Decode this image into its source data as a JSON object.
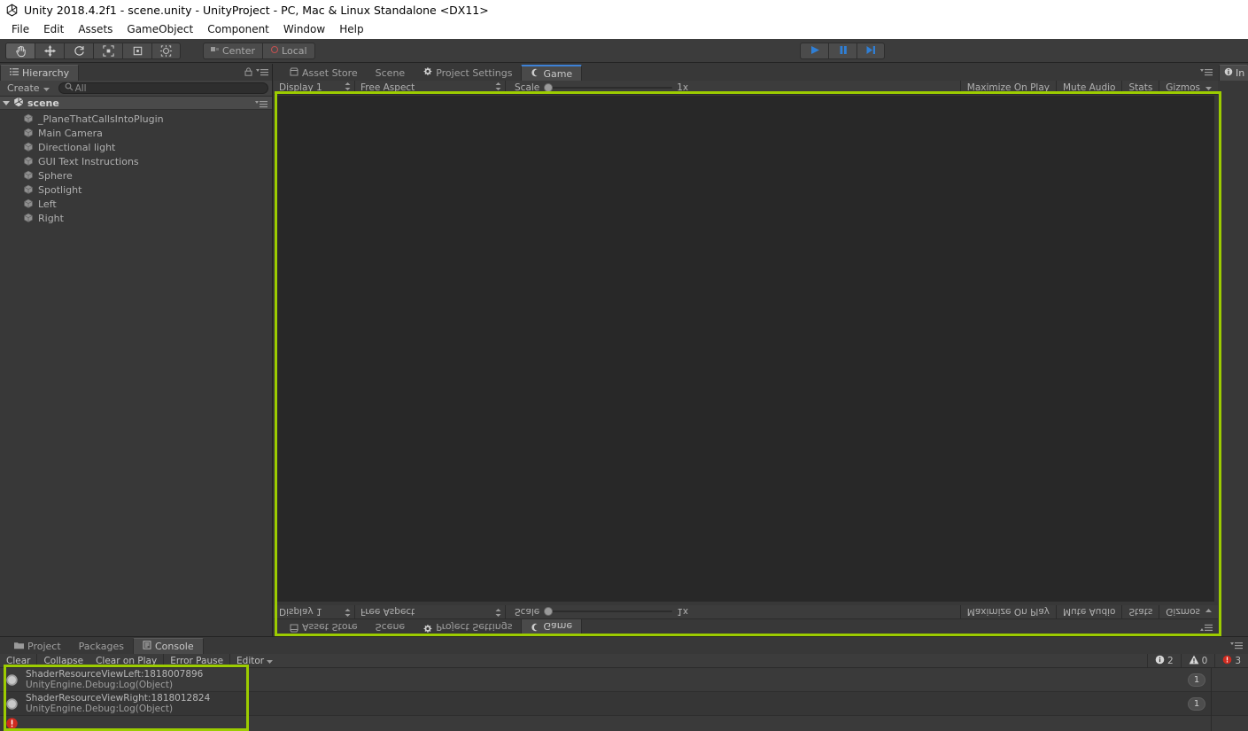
{
  "window": {
    "title": "Unity 2018.4.2f1 - scene.unity - UnityProject - PC, Mac & Linux Standalone <DX11>",
    "logo_icon": "unity-logo-icon"
  },
  "menubar": {
    "items": [
      {
        "label": "File"
      },
      {
        "label": "Edit"
      },
      {
        "label": "Assets"
      },
      {
        "label": "GameObject"
      },
      {
        "label": "Component"
      },
      {
        "label": "Window"
      },
      {
        "label": "Help"
      }
    ]
  },
  "toolbar": {
    "tools": [
      {
        "name": "hand-tool",
        "icon": "hand-icon",
        "active": true
      },
      {
        "name": "move-tool",
        "icon": "move-icon",
        "active": false
      },
      {
        "name": "rotate-tool",
        "icon": "rotate-icon",
        "active": false
      },
      {
        "name": "scale-tool",
        "icon": "scale-icon",
        "active": false
      },
      {
        "name": "rect-tool",
        "icon": "rect-transform-icon",
        "active": false
      },
      {
        "name": "transform-tool",
        "icon": "transform-icon",
        "active": false
      }
    ],
    "pivot_label": "Center",
    "pivot_icon": "pivot-center-icon",
    "space_label": "Local",
    "space_icon": "local-space-icon",
    "play_label": "play-button",
    "pause_label": "pause-button",
    "step_label": "step-button",
    "play_accent": "#2f7fd6"
  },
  "hierarchy": {
    "tab_label": "Hierarchy",
    "tab_icon": "hierarchy-icon",
    "lock_icon": "lock-icon",
    "options_icon": "panel-options-icon",
    "create_label": "Create",
    "search_placeholder": "All",
    "search_value": "",
    "search_icon": "search-icon",
    "scene_name": "scene",
    "scene_icon": "unity-scene-icon",
    "items": [
      {
        "label": "_PlaneThatCallsIntoPlugin",
        "icon": "gameobject-cube-icon"
      },
      {
        "label": "Main Camera",
        "icon": "gameobject-cube-icon"
      },
      {
        "label": "Directional light",
        "icon": "gameobject-cube-icon"
      },
      {
        "label": "GUI Text Instructions",
        "icon": "gameobject-cube-icon"
      },
      {
        "label": "Sphere",
        "icon": "gameobject-cube-icon"
      },
      {
        "label": "Spotlight",
        "icon": "gameobject-cube-icon"
      },
      {
        "label": "Left",
        "icon": "gameobject-cube-icon"
      },
      {
        "label": "Right",
        "icon": "gameobject-cube-icon"
      }
    ]
  },
  "gameview": {
    "tabs": [
      {
        "label": "Asset Store",
        "icon": "asset-store-icon",
        "active": false
      },
      {
        "label": "Scene",
        "icon": "",
        "active": false
      },
      {
        "label": "Project Settings",
        "icon": "settings-gear-icon",
        "active": false
      },
      {
        "label": "Game",
        "icon": "game-icon",
        "active": true
      }
    ],
    "display_label": "Display 1",
    "aspect_label": "Free Aspect",
    "scale_label": "Scale",
    "scale_value": "1x",
    "maximize_label": "Maximize On Play",
    "mute_label": "Mute Audio",
    "stats_label": "Stats",
    "gizmos_label": "Gizmos",
    "options_icon": "panel-options-icon",
    "canvas_color": "#282828",
    "highlight_color": "#9ccc00"
  },
  "inspector": {
    "tab_label": "In",
    "tab_icon": "inspector-info-icon"
  },
  "console": {
    "tabs": [
      {
        "label": "Project",
        "icon": "folder-icon",
        "active": false
      },
      {
        "label": "Packages",
        "icon": "",
        "active": false
      },
      {
        "label": "Console",
        "icon": "console-icon",
        "active": true
      }
    ],
    "buttons": [
      {
        "label": "Clear",
        "name": "clear-button"
      },
      {
        "label": "Collapse",
        "name": "collapse-toggle"
      },
      {
        "label": "Clear on Play",
        "name": "clear-on-play-toggle"
      },
      {
        "label": "Error Pause",
        "name": "error-pause-toggle"
      },
      {
        "label": "Editor",
        "name": "editor-dropdown"
      }
    ],
    "counts": {
      "info_icon": "info-icon",
      "info": "2",
      "warning_icon": "warning-icon",
      "warning": "0",
      "error_icon": "error-icon",
      "error": "3"
    },
    "options_icon": "panel-options-icon",
    "entries": [
      {
        "icon": "info-log-icon",
        "line1": "ShaderResourceViewLeft:1818007896",
        "line2": "UnityEngine.Debug:Log(Object)",
        "count": "1"
      },
      {
        "icon": "info-log-icon",
        "line1": "ShaderResourceViewRight:1818012824",
        "line2": "UnityEngine.Debug:Log(Object)",
        "count": "1"
      },
      {
        "icon": "error-log-icon",
        "line1": "",
        "line2": "",
        "count": ""
      }
    ]
  }
}
